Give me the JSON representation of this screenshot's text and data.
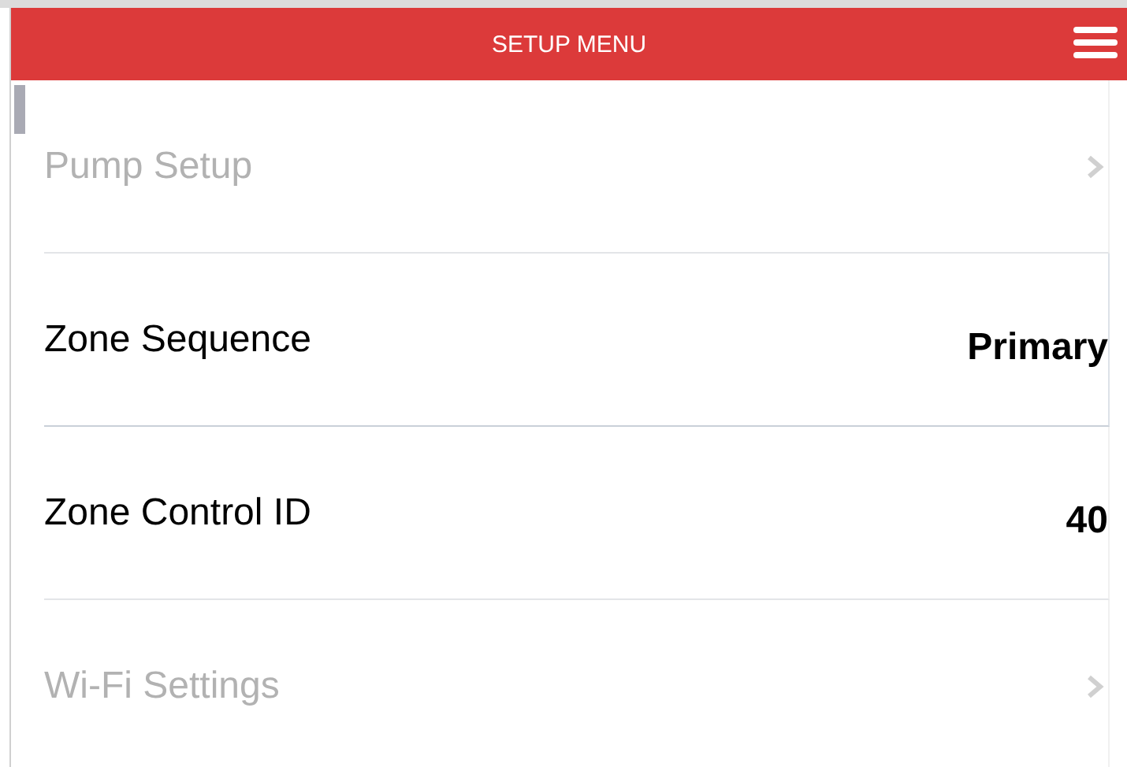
{
  "header": {
    "title": "SETUP MENU"
  },
  "rows": [
    {
      "kind": "link",
      "label": "Pump Setup",
      "disabled": true,
      "selected": false
    },
    {
      "kind": "value",
      "label": "Zone Sequence",
      "value": "Primary",
      "disabled": false,
      "selected": true
    },
    {
      "kind": "value",
      "label": "Zone Control ID",
      "value": "40",
      "disabled": false,
      "selected": false
    },
    {
      "kind": "link",
      "label": "Wi-Fi Settings",
      "disabled": true,
      "selected": false
    }
  ]
}
